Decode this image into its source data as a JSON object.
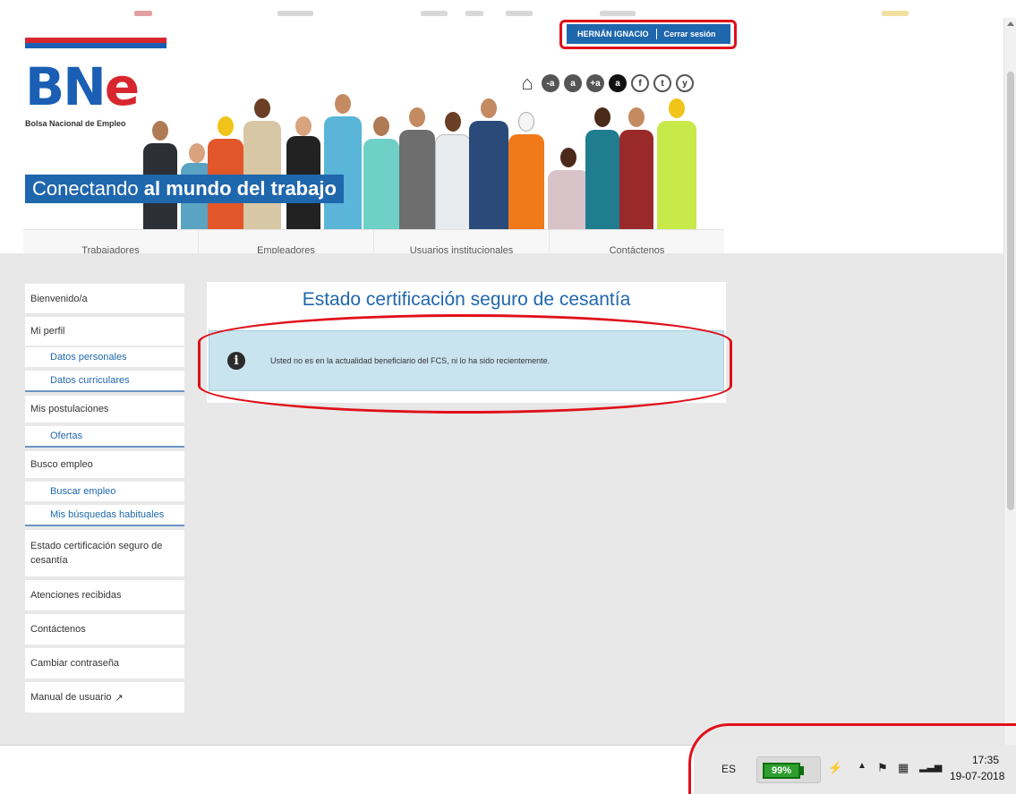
{
  "logo": {
    "bn": "BN",
    "e": "e",
    "subtitle": "Bolsa Nacional de Empleo"
  },
  "tagline": {
    "normal": "Conectando ",
    "bold": "al mundo del trabajo"
  },
  "userbar": {
    "user": "HERNÁN IGNACIO",
    "logout": "Cerrar sesión"
  },
  "accessibility": [
    "-a",
    "a",
    "+a",
    "a"
  ],
  "social": [
    "f",
    "t",
    "y"
  ],
  "nav": {
    "tabs": [
      "Trabajadores",
      "Empleadores",
      "Usuarios institucionales",
      "Contáctenos"
    ]
  },
  "sidebar": {
    "items": [
      {
        "label": "Bienvenido/a",
        "type": "item"
      },
      {
        "label": "Mi perfil",
        "type": "item"
      },
      {
        "label": "Datos personales",
        "type": "sub"
      },
      {
        "label": "Datos curriculares",
        "type": "sub-last"
      },
      {
        "label": "Mis postulaciones",
        "type": "item"
      },
      {
        "label": "Ofertas",
        "type": "sub-last"
      },
      {
        "label": "Busco empleo",
        "type": "item"
      },
      {
        "label": "Buscar empleo",
        "type": "sub"
      },
      {
        "label": "Mis búsquedas habituales",
        "type": "sub-last"
      },
      {
        "label": "Estado certificación seguro de cesantía",
        "type": "item-tall"
      },
      {
        "label": "Atenciones recibidas",
        "type": "item"
      },
      {
        "label": "Contáctenos",
        "type": "item"
      },
      {
        "label": "Cambiar contraseña",
        "type": "item"
      },
      {
        "label": "Manual de usuario",
        "type": "item-ext"
      }
    ]
  },
  "panel": {
    "title": "Estado certificación seguro de cesantía",
    "alert": "Usted no es en la actualidad beneficiario del FCS, ni lo ha sido recientemente."
  },
  "taskbar": {
    "lang": "ES",
    "battery": "99%",
    "time": "17:35",
    "date": "19-07-2018"
  },
  "colors": {
    "brand_blue": "#1f67ad",
    "brand_red": "#d8262e",
    "highlight": "#e0101a"
  }
}
